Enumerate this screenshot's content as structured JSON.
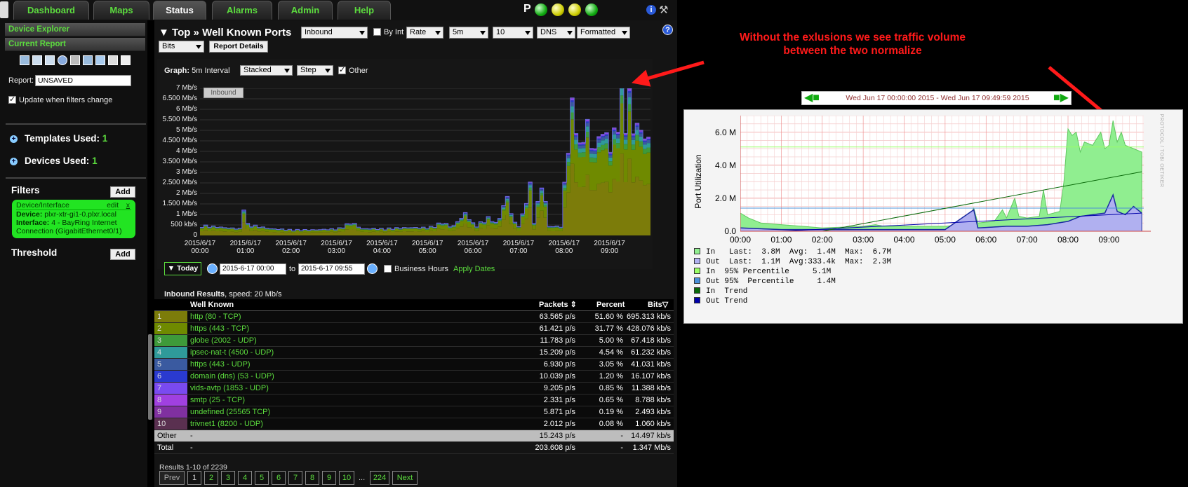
{
  "nav": {
    "tabs": [
      "Dashboard",
      "Maps",
      "Status",
      "Alarms",
      "Admin",
      "Help"
    ],
    "active": "Status",
    "p_label": "P"
  },
  "sidebar": {
    "device_explorer": "Device Explorer",
    "current_report": "Current Report",
    "report_label": "Report:",
    "report_value": "UNSAVED",
    "update_label": "Update when filters change",
    "templates_label": "Templates Used:",
    "templates_count": "1",
    "devices_label": "Devices Used:",
    "devices_count": "1",
    "filters_label": "Filters",
    "add_label": "Add",
    "filter_card": {
      "title": "Device/Interface",
      "edit": "edit",
      "close": "x",
      "device_key": "Device:",
      "device_val": "plxr-xtr-gi1-0.plxr.local",
      "iface_key": "Interface:",
      "iface_val": "4 - BayRing Internet Connection (GigabitEthernet0/1)"
    },
    "threshold_label": "Threshold"
  },
  "report": {
    "title": "▼ Top » Well Known Ports",
    "selects": [
      "Inbound",
      "Rate",
      "5m",
      "10",
      "DNS",
      "Formatted",
      "Bits"
    ],
    "by_int": "By Int",
    "report_details": "Report Details",
    "graph_label": "Graph:",
    "graph_interval": "5m Interval",
    "graph_selects": [
      "Stacked",
      "Step"
    ],
    "other_label": "Other",
    "legend_tag": "Inbound",
    "today": "▼ Today",
    "date_from": "2015-6-17 00:00",
    "date_to_label": "to",
    "date_to": "2015-6-17 09:55",
    "business_hours": "Business Hours",
    "apply_dates": "Apply Dates",
    "results_label": "Inbound Results",
    "results_speed": ", speed: 20 Mb/s"
  },
  "chart_data": {
    "type": "area",
    "title": "",
    "y_ticks": [
      "7 Mb/s",
      "6.500 Mb/s",
      "6 Mb/s",
      "5.500 Mb/s",
      "5 Mb/s",
      "4.500 Mb/s",
      "4 Mb/s",
      "3.500 Mb/s",
      "3 Mb/s",
      "2.500 Mb/s",
      "2 Mb/s",
      "1.500 Mb/s",
      "1 Mb/s",
      "500 kb/s",
      "0"
    ],
    "x_ticks": [
      [
        "2015/6/17",
        "00:00"
      ],
      [
        "2015/6/17",
        "01:00"
      ],
      [
        "2015/6/17",
        "02:00"
      ],
      [
        "2015/6/17",
        "03:00"
      ],
      [
        "2015/6/17",
        "04:00"
      ],
      [
        "2015/6/17",
        "05:00"
      ],
      [
        "2015/6/17",
        "06:00"
      ],
      [
        "2015/6/17",
        "07:00"
      ],
      [
        "2015/6/17",
        "08:00"
      ],
      [
        "2015/6/17",
        "09:00"
      ]
    ],
    "ylim": [
      0,
      7
    ],
    "x_range_hours": [
      0,
      9.9
    ],
    "grid": true,
    "series_colors": [
      "#7c7c0a",
      "#6f8a00",
      "#3e9a3a",
      "#2f9a9a",
      "#3a5aa0",
      "#2a3ad0",
      "#7a4af0",
      "#a040e0",
      "#8030a0",
      "#5a3050"
    ],
    "total_mbps": [
      [
        0.0,
        0.45
      ],
      [
        0.5,
        0.35
      ],
      [
        0.85,
        0.3
      ],
      [
        0.9,
        1.6
      ],
      [
        1.0,
        0.5
      ],
      [
        1.5,
        0.3
      ],
      [
        2.0,
        0.25
      ],
      [
        2.5,
        0.25
      ],
      [
        3.0,
        0.3
      ],
      [
        3.3,
        0.6
      ],
      [
        3.5,
        0.3
      ],
      [
        4.0,
        0.3
      ],
      [
        4.5,
        0.35
      ],
      [
        5.0,
        0.35
      ],
      [
        5.3,
        0.6
      ],
      [
        5.5,
        0.35
      ],
      [
        5.8,
        1.0
      ],
      [
        6.0,
        0.4
      ],
      [
        6.3,
        0.8
      ],
      [
        6.5,
        0.5
      ],
      [
        6.7,
        1.8
      ],
      [
        6.85,
        0.6
      ],
      [
        7.0,
        0.4
      ],
      [
        7.2,
        2.5
      ],
      [
        7.3,
        0.6
      ],
      [
        7.5,
        2.6
      ],
      [
        7.6,
        0.4
      ],
      [
        7.9,
        0.4
      ],
      [
        8.0,
        3.0
      ],
      [
        8.1,
        5.5
      ],
      [
        8.2,
        6.0
      ],
      [
        8.3,
        3.8
      ],
      [
        8.45,
        5.2
      ],
      [
        8.6,
        3.6
      ],
      [
        8.8,
        4.8
      ],
      [
        8.95,
        4.1
      ],
      [
        9.1,
        4.6
      ],
      [
        9.2,
        7.0
      ],
      [
        9.3,
        5.2
      ],
      [
        9.4,
        6.2
      ],
      [
        9.5,
        4.6
      ],
      [
        9.6,
        5.0
      ],
      [
        9.75,
        4.3
      ],
      [
        9.9,
        4.2
      ]
    ]
  },
  "table": {
    "headers": {
      "name": "Well Known",
      "packets": "Packets",
      "percent": "Percent",
      "bits": "Bits"
    },
    "rows": [
      {
        "n": "1",
        "name": "http (80 - TCP)",
        "packets": "63.565 p/s",
        "percent": "51.60 %",
        "bits": "695.313 kb/s",
        "color": "#7c7c0a"
      },
      {
        "n": "2",
        "name": "https (443 - TCP)",
        "packets": "61.421 p/s",
        "percent": "31.77 %",
        "bits": "428.076 kb/s",
        "color": "#6f8a00"
      },
      {
        "n": "3",
        "name": "globe (2002 - UDP)",
        "packets": "11.783 p/s",
        "percent": "5.00 %",
        "bits": "67.418 kb/s",
        "color": "#3e9a3a"
      },
      {
        "n": "4",
        "name": "ipsec-nat-t (4500 - UDP)",
        "packets": "15.209 p/s",
        "percent": "4.54 %",
        "bits": "61.232 kb/s",
        "color": "#2f9a9a"
      },
      {
        "n": "5",
        "name": "https (443 - UDP)",
        "packets": "6.930 p/s",
        "percent": "3.05 %",
        "bits": "41.031 kb/s",
        "color": "#3a5aa0"
      },
      {
        "n": "6",
        "name": "domain (dns) (53 - UDP)",
        "packets": "10.039 p/s",
        "percent": "1.20 %",
        "bits": "16.107 kb/s",
        "color": "#2a3ad0"
      },
      {
        "n": "7",
        "name": "vids-avtp (1853 - UDP)",
        "packets": "9.205 p/s",
        "percent": "0.85 %",
        "bits": "11.388 kb/s",
        "color": "#7a4af0"
      },
      {
        "n": "8",
        "name": "smtp (25 - TCP)",
        "packets": "2.331 p/s",
        "percent": "0.65 %",
        "bits": "8.788 kb/s",
        "color": "#a040e0"
      },
      {
        "n": "9",
        "name": "undefined (25565 TCP)",
        "packets": "5.871 p/s",
        "percent": "0.19 %",
        "bits": "2.493 kb/s",
        "color": "#8030a0"
      },
      {
        "n": "10",
        "name": "trivnet1 (8200 - UDP)",
        "packets": "2.012 p/s",
        "percent": "0.08 %",
        "bits": "1.060 kb/s",
        "color": "#5a3050"
      }
    ],
    "other": {
      "label": "Other",
      "name": "-",
      "packets": "15.243 p/s",
      "percent": "-",
      "bits": "14.497 kb/s"
    },
    "total": {
      "label": "Total",
      "name": "-",
      "packets": "203.608 p/s",
      "percent": "-",
      "bits": "1.347 Mb/s"
    }
  },
  "pagination": {
    "summary": "Results 1-10 of 2239",
    "prev": "Prev",
    "pages": [
      "1",
      "2",
      "3",
      "4",
      "5",
      "6",
      "7",
      "8",
      "9",
      "10"
    ],
    "ellipsis": "...",
    "last": "224",
    "next": "Next"
  },
  "annotation": {
    "line1": "Without the exlusions we see traffic volume",
    "line2": "between the two normalize",
    "color": "#ff1a1a"
  },
  "rrd": {
    "date_range": "Wed Jun 17 00:00:00 2015 - Wed Jun 17 09:49:59 2015",
    "ylabel": "Port Utilization",
    "y_ticks": [
      "6.0 M",
      "4.0 M",
      "2.0 M",
      "0.0"
    ],
    "x_ticks": [
      "00:00",
      "01:00",
      "02:00",
      "03:00",
      "04:00",
      "05:00",
      "06:00",
      "07:00",
      "08:00",
      "09:00"
    ],
    "side_text": "PROTOCOL / TOBI OETIKER",
    "legend": [
      {
        "text": "In   Last:  3.8M  Avg:  1.4M  Max:  6.7M",
        "color": "#90ee90"
      },
      {
        "text": "Out  Last:  1.1M  Avg:333.4k  Max:  2.3M",
        "color": "#b0b0f0"
      },
      {
        "text": "In  95% Percentile     5.1M",
        "color": "#99ff66"
      },
      {
        "text": "Out 95%  Percentile     1.4M",
        "color": "#4a90d9"
      },
      {
        "text": "In  Trend",
        "color": "#0a6a0a"
      },
      {
        "text": "Out Trend",
        "color": "#0000aa"
      }
    ],
    "in_mbps": [
      [
        0,
        1.1
      ],
      [
        0.2,
        0.8
      ],
      [
        0.5,
        0.5
      ],
      [
        1.0,
        0.4
      ],
      [
        1.5,
        0.3
      ],
      [
        2.0,
        0.2
      ],
      [
        2.5,
        0.25
      ],
      [
        3.0,
        0.3
      ],
      [
        3.3,
        0.4
      ],
      [
        3.5,
        0.3
      ],
      [
        4.0,
        0.3
      ],
      [
        4.5,
        0.3
      ],
      [
        5.0,
        0.3
      ],
      [
        5.5,
        0.4
      ],
      [
        5.7,
        1.4
      ],
      [
        5.8,
        0.5
      ],
      [
        6.2,
        0.6
      ],
      [
        6.4,
        1.3
      ],
      [
        6.5,
        0.8
      ],
      [
        6.7,
        2.0
      ],
      [
        6.8,
        0.9
      ],
      [
        7.0,
        0.8
      ],
      [
        7.3,
        0.9
      ],
      [
        7.4,
        2.5
      ],
      [
        7.5,
        1.0
      ],
      [
        7.8,
        1.2
      ],
      [
        7.9,
        3.0
      ],
      [
        8.0,
        6.2
      ],
      [
        8.1,
        5.8
      ],
      [
        8.2,
        6.0
      ],
      [
        8.3,
        4.8
      ],
      [
        8.4,
        5.4
      ],
      [
        8.6,
        5.2
      ],
      [
        8.8,
        6.0
      ],
      [
        8.9,
        5.0
      ],
      [
        9.0,
        5.2
      ],
      [
        9.1,
        6.7
      ],
      [
        9.2,
        5.4
      ],
      [
        9.3,
        6.0
      ],
      [
        9.4,
        5.2
      ],
      [
        9.6,
        5.0
      ],
      [
        9.8,
        4.8
      ]
    ],
    "out_mbps": [
      [
        0,
        0.2
      ],
      [
        1.0,
        0.1
      ],
      [
        2.0,
        0.1
      ],
      [
        3.0,
        0.1
      ],
      [
        4.0,
        0.1
      ],
      [
        5.0,
        0.1
      ],
      [
        5.7,
        1.3
      ],
      [
        5.8,
        0.2
      ],
      [
        6.5,
        0.3
      ],
      [
        7.0,
        0.3
      ],
      [
        7.5,
        0.4
      ],
      [
        8.0,
        0.6
      ],
      [
        8.3,
        0.9
      ],
      [
        8.6,
        1.0
      ],
      [
        8.9,
        1.1
      ],
      [
        9.1,
        2.2
      ],
      [
        9.2,
        1.2
      ],
      [
        9.4,
        1.0
      ],
      [
        9.6,
        1.5
      ],
      [
        9.8,
        1.1
      ]
    ],
    "in_p95": 5.1,
    "out_p95": 1.4,
    "in_trend": [
      [
        2.0,
        0.0
      ],
      [
        9.8,
        3.6
      ]
    ],
    "out_trend": [
      [
        1.0,
        0.0
      ],
      [
        9.8,
        1.1
      ]
    ],
    "ylim": [
      0,
      7
    ]
  }
}
